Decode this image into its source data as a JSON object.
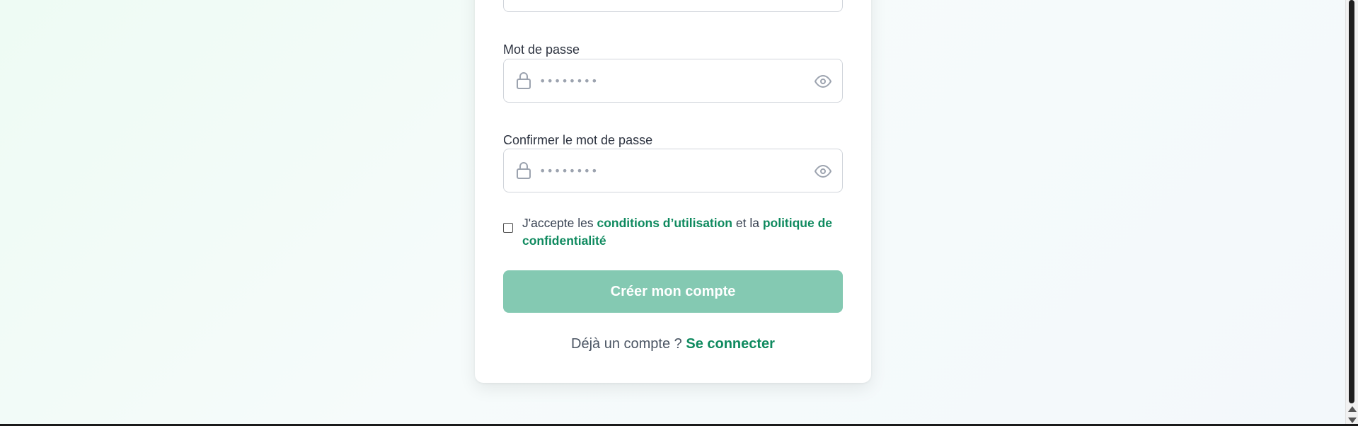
{
  "form": {
    "password": {
      "label": "Mot de passe",
      "placeholder": "••••••••"
    },
    "confirm_password": {
      "label": "Confirmer le mot de passe",
      "placeholder": "••••••••"
    },
    "terms": {
      "prefix": "J'accepte les ",
      "terms_link": "conditions d’utilisation",
      "middle": " et la ",
      "privacy_link": "politique de confidentialité",
      "checked": false
    },
    "submit_label": "Créer mon compte",
    "login_prompt": "Déjà un compte ? ",
    "login_link": "Se connecter"
  },
  "colors": {
    "accent": "#0f8a5f",
    "button_disabled": "#84c9b2",
    "icon_gray": "#9ca3af"
  },
  "icons": {
    "field_leading": "lock-icon",
    "field_trailing": "eye-icon"
  }
}
